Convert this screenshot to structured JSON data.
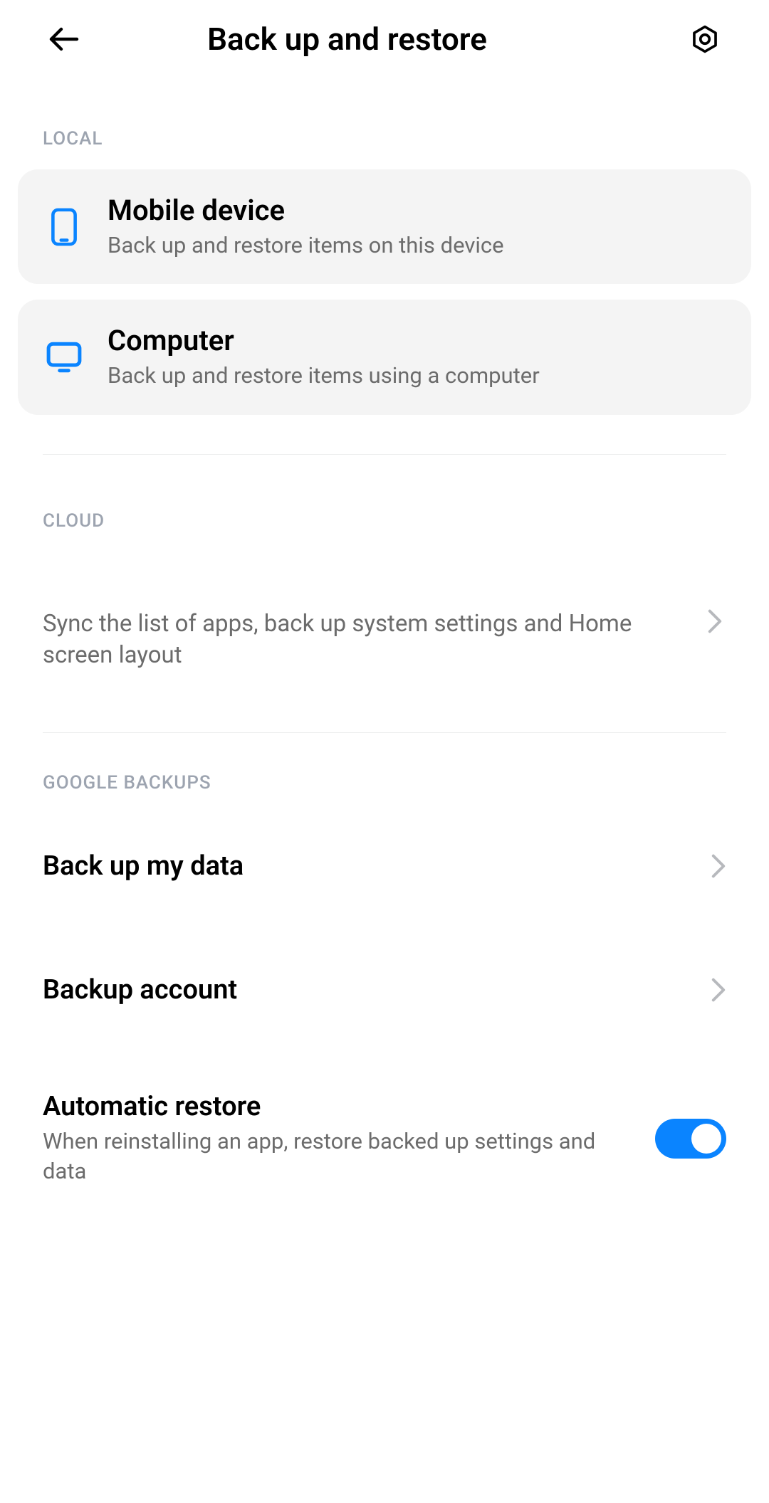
{
  "header": {
    "title": "Back up and restore"
  },
  "sections": {
    "local": {
      "label": "LOCAL",
      "items": [
        {
          "title": "Mobile device",
          "desc": "Back up and restore items on this device"
        },
        {
          "title": "Computer",
          "desc": "Back up and restore items using a computer"
        }
      ]
    },
    "cloud": {
      "label": "CLOUD",
      "desc": "Sync the list of apps, back up system settings and Home screen layout"
    },
    "google": {
      "label": "GOOGLE BACKUPS",
      "items": [
        {
          "title": "Back up my data"
        },
        {
          "title": "Backup account"
        },
        {
          "title": "Automatic restore",
          "desc": "When reinstalling an app, restore backed up settings and data",
          "toggle": true
        }
      ]
    }
  }
}
